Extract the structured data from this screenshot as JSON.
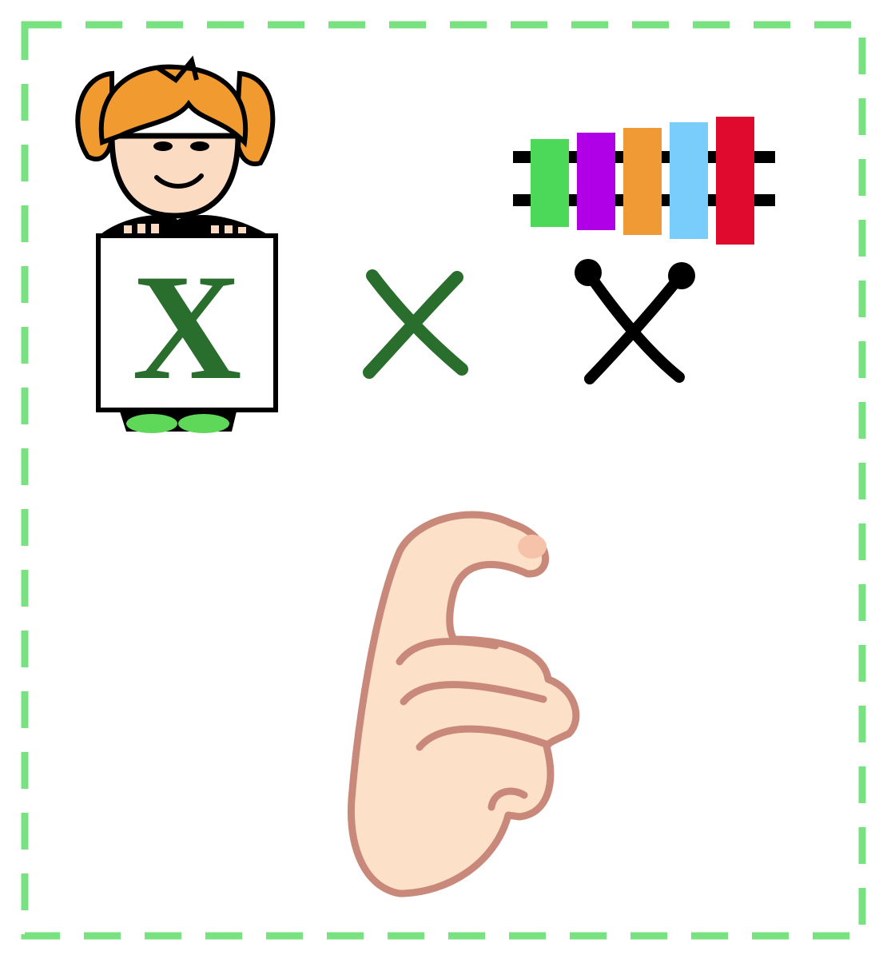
{
  "card": {
    "border_color": "#77e27f",
    "background": "#ffffff"
  },
  "sign": {
    "letter": "X"
  },
  "colors": {
    "hair": "#f09a2f",
    "skin": "#fbdcc2",
    "letter_green": "#2a6e2d",
    "shoe_green": "#5fd85a",
    "hand_fill": "#fde0c8",
    "hand_outline": "#c8887a"
  },
  "xylophone": {
    "bar_colors": [
      "#4cd95a",
      "#b000e8",
      "#f09a35",
      "#78cdfb",
      "#e0092e"
    ]
  },
  "icons": {
    "child": "child-holding-sign-icon",
    "small_x": "lowercase-x-icon",
    "mallets": "crossed-mallets-icon",
    "xylophone": "xylophone-icon",
    "hand": "sign-language-hand-x-icon"
  }
}
